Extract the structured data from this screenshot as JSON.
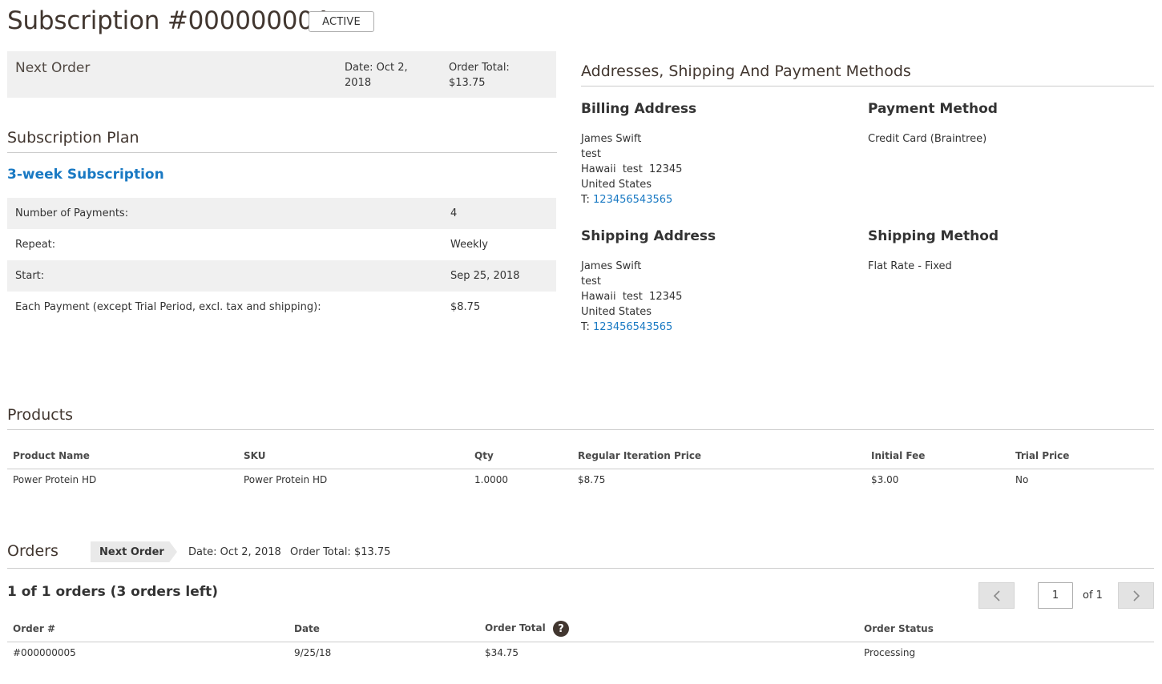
{
  "header": {
    "title": "Subscription #000000004",
    "status": "ACTIVE"
  },
  "next_order": {
    "label": "Next Order",
    "date": "Date: Oct 2, 2018",
    "total": "Order Total: $13.75"
  },
  "plan": {
    "section_title": "Subscription Plan",
    "name": "3-week Subscription",
    "rows": [
      {
        "label": "Number of Payments:",
        "value": "4"
      },
      {
        "label": "Repeat:",
        "value": "Weekly"
      },
      {
        "label": "Start:",
        "value": "Sep 25, 2018"
      },
      {
        "label": "Each Payment (except Trial Period, excl. tax and shipping):",
        "value": "$8.75"
      }
    ]
  },
  "addresses": {
    "section_title": "Addresses, Shipping And Payment Methods",
    "billing": {
      "title": "Billing Address",
      "name": "James Swift",
      "line1": "test",
      "line2": "Hawaii  test  12345",
      "country": "United States",
      "phone_prefix": "T: ",
      "phone": "123456543565"
    },
    "payment": {
      "title": "Payment Method",
      "value": "Credit Card (Braintree)"
    },
    "shipping": {
      "title": "Shipping Address",
      "name": "James Swift",
      "line1": "test",
      "line2": "Hawaii  test  12345",
      "country": "United States",
      "phone_prefix": "T: ",
      "phone": "123456543565"
    },
    "shipping_method": {
      "title": "Shipping Method",
      "value": "Flat Rate - Fixed"
    }
  },
  "products": {
    "section_title": "Products",
    "columns": [
      "Product Name",
      "SKU",
      "Qty",
      "Regular Iteration Price",
      "Initial Fee",
      "Trial Price"
    ],
    "rows": [
      [
        "Power Protein HD",
        "Power Protein HD",
        "1.0000",
        "$8.75",
        "$3.00",
        "No"
      ]
    ]
  },
  "orders": {
    "section_title": "Orders",
    "next_tag": "Next Order",
    "next_date": "Date: Oct 2, 2018",
    "next_total": "Order Total: $13.75",
    "count_text": "1 of 1 orders (3 orders left)",
    "pager": {
      "page": "1",
      "of_text": "of 1"
    },
    "columns": [
      "Order #",
      "Date",
      "Order Total",
      "Order Status"
    ],
    "rows": [
      [
        "#000000005",
        "9/25/18",
        "$34.75",
        "Processing"
      ]
    ]
  }
}
